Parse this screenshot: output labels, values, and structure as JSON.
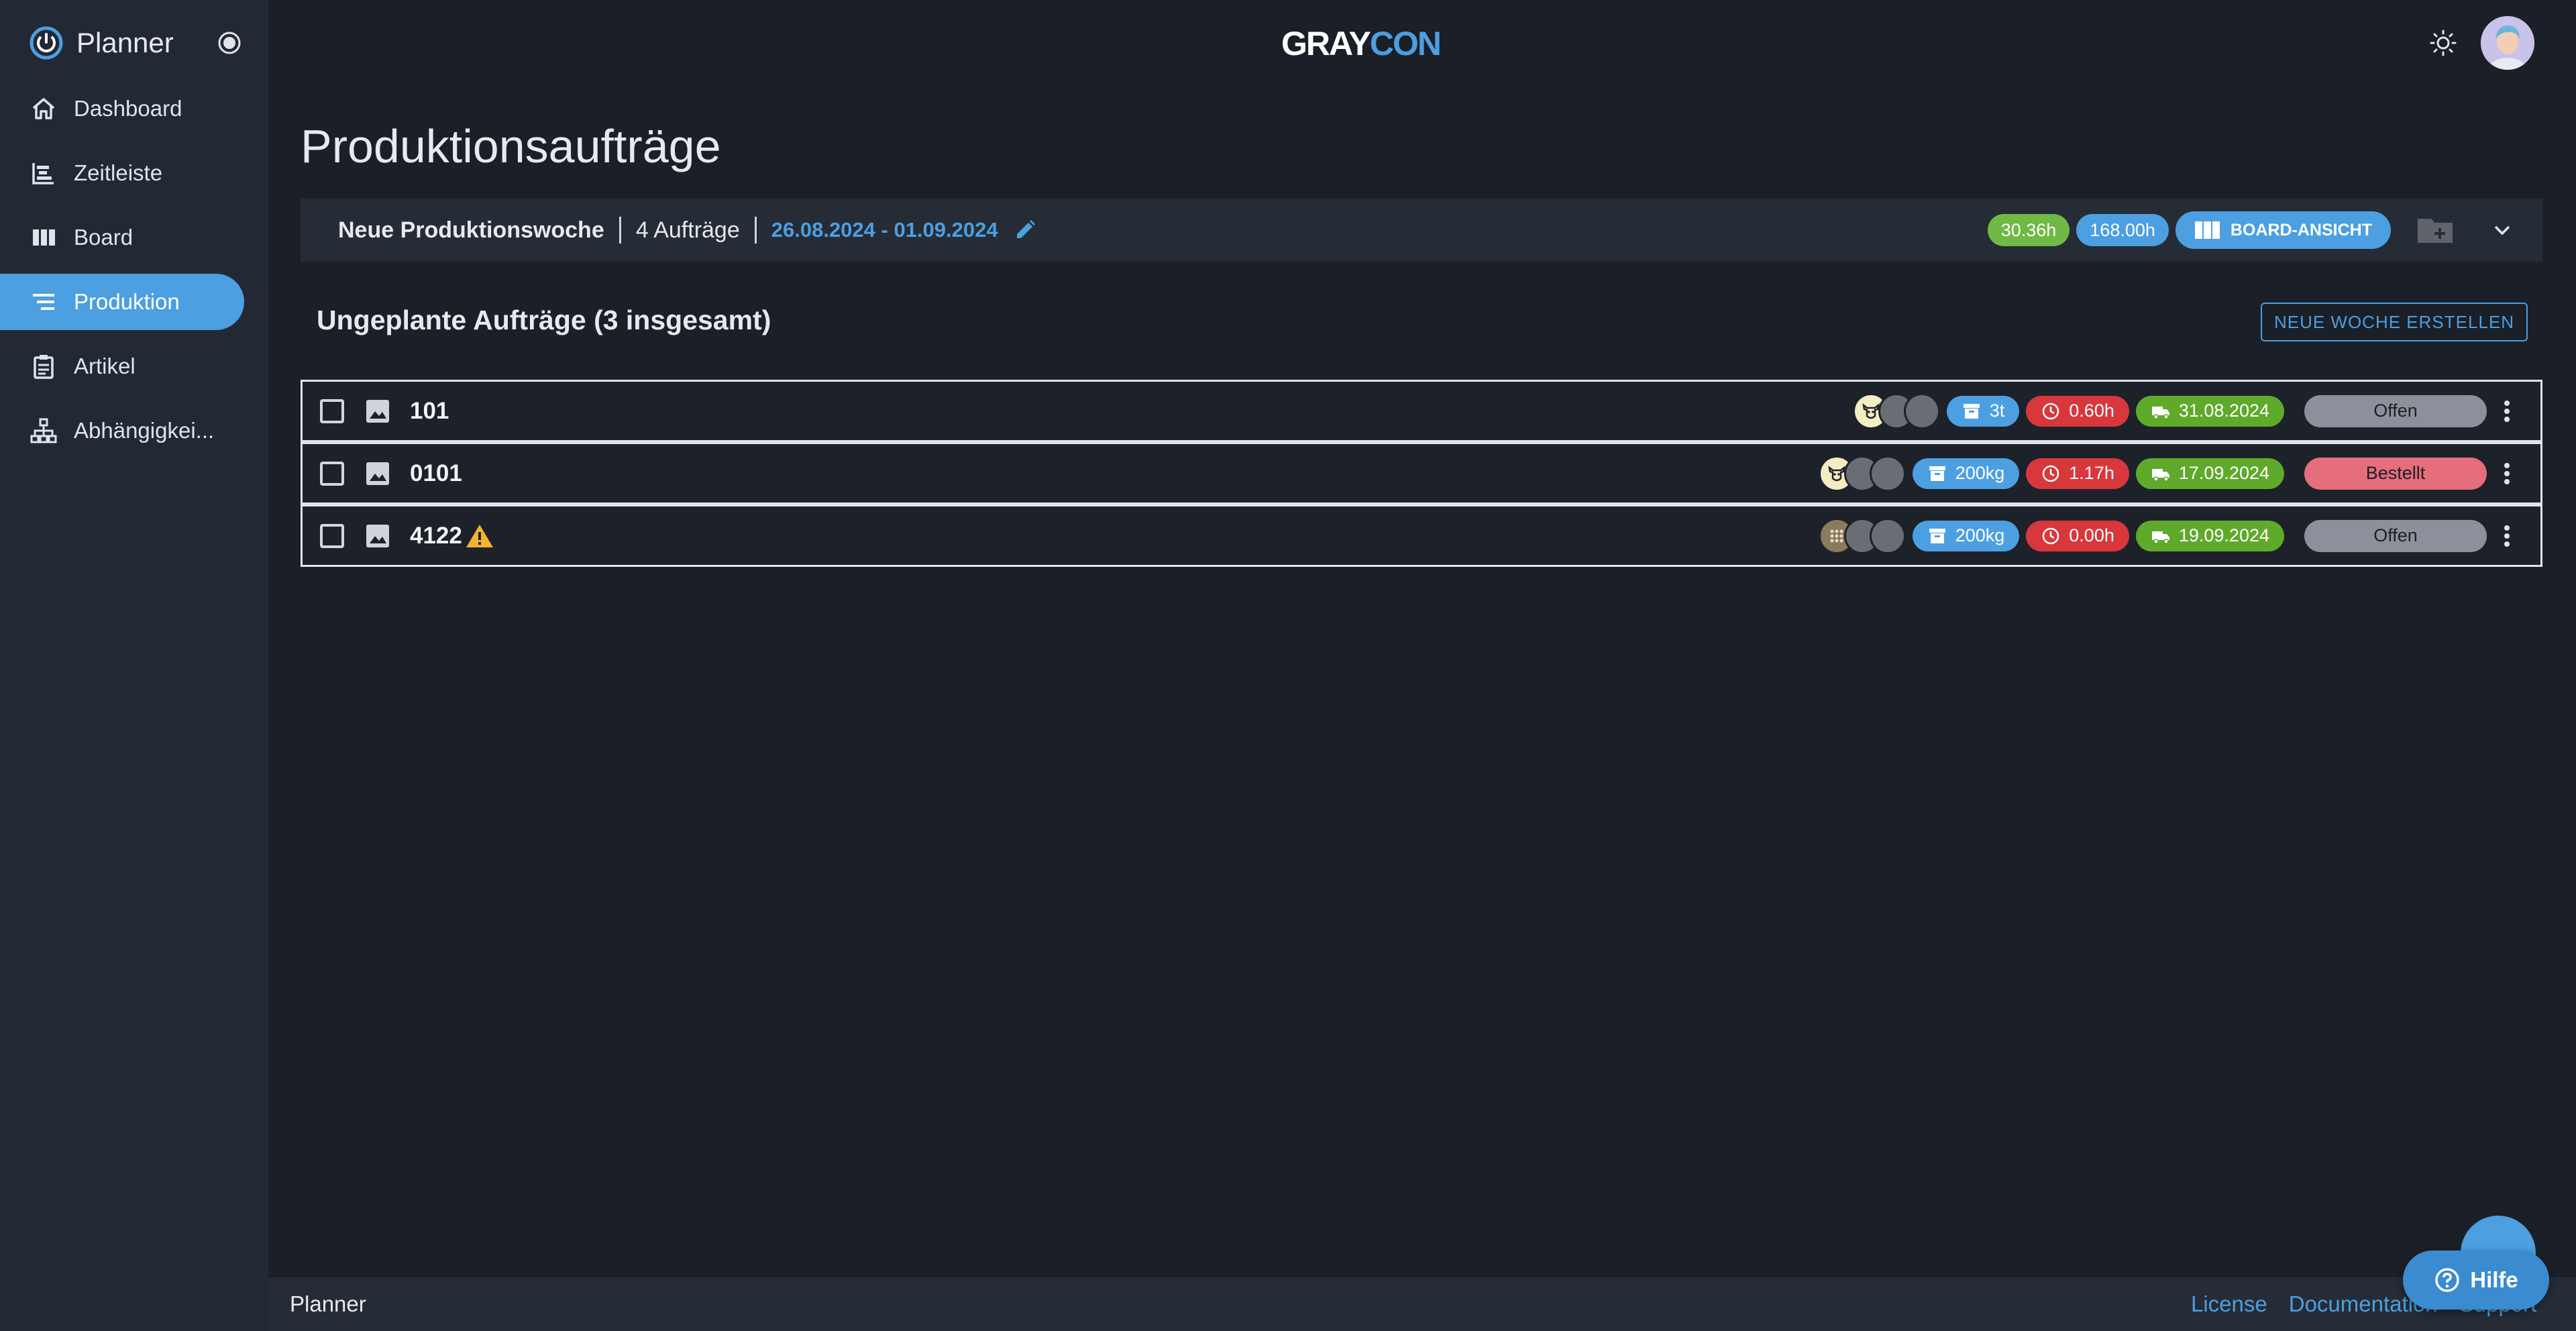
{
  "app": {
    "title": "Planner",
    "logo_part1": "GRAY",
    "logo_part2": "CON",
    "accent_color": "#4c9fe0"
  },
  "sidebar": {
    "items": [
      {
        "label": "Dashboard",
        "icon": "home-icon"
      },
      {
        "label": "Zeitleiste",
        "icon": "timeline-icon"
      },
      {
        "label": "Board",
        "icon": "board-icon"
      },
      {
        "label": "Produktion",
        "icon": "production-icon",
        "active": true
      },
      {
        "label": "Artikel",
        "icon": "clipboard-icon"
      },
      {
        "label": "Abhängigkei...",
        "icon": "hierarchy-icon"
      }
    ]
  },
  "page": {
    "title": "Produktionsaufträge"
  },
  "week": {
    "name": "Neue Produktionswoche",
    "count": "4 Aufträge",
    "dates": "26.08.2024 - 01.09.2024",
    "hours_used": "30.36h",
    "hours_total": "168.00h",
    "board_view_label": "BOARD-ANSICHT"
  },
  "unplanned": {
    "title": "Ungeplante Aufträge (3 insgesamt)",
    "new_week_label": "NEUE WOCHE ERSTELLEN"
  },
  "orders": [
    {
      "id": "101",
      "warning": false,
      "emblem": "cow",
      "quantity": "3t",
      "duration": "0.60h",
      "delivery": "31.08.2024",
      "status": "Offen",
      "status_color": "#8d909a"
    },
    {
      "id": "0101",
      "warning": false,
      "emblem": "cow",
      "quantity": "200kg",
      "duration": "1.17h",
      "delivery": "17.09.2024",
      "status": "Bestellt",
      "status_color": "#e56d7c"
    },
    {
      "id": "4122",
      "warning": true,
      "emblem": "grid",
      "quantity": "200kg",
      "duration": "0.00h",
      "delivery": "19.09.2024",
      "status": "Offen",
      "status_color": "#8d909a"
    }
  ],
  "footer": {
    "name": "Planner",
    "links": [
      "License",
      "Documentation",
      "Support"
    ]
  },
  "help": {
    "label": "Hilfe"
  }
}
